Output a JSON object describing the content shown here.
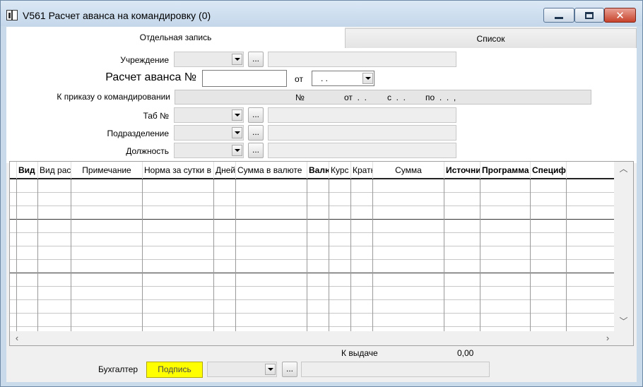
{
  "window": {
    "title": "V561 Расчет аванса на командировку (0)",
    "icon": "book-icon"
  },
  "tabs": [
    {
      "label": "Отдельная запись",
      "active": true
    },
    {
      "label": "Список",
      "active": false
    }
  ],
  "form": {
    "institution_label": "Учреждение",
    "advance_label": "Расчет аванса №",
    "advance_number": "",
    "from_label": "от",
    "date_value": ". .",
    "order_label": "К приказу о командировании",
    "order_parts": {
      "num": "№",
      "from": "от  .  .",
      "s": "с  .  .",
      "po": "по  .  .  ,"
    },
    "tab_label": "Таб №",
    "department_label": "Подразделение",
    "position_label": "Должность",
    "dots": "..."
  },
  "grid": {
    "columns": [
      {
        "label": "Вид",
        "bold": true
      },
      {
        "label": "Вид рас",
        "bold": false
      },
      {
        "label": "Примечание",
        "bold": false
      },
      {
        "label": "Норма за сутки в",
        "bold": false
      },
      {
        "label": "Дней",
        "bold": false
      },
      {
        "label": "Сумма в валюте",
        "bold": false
      },
      {
        "label": "Валю",
        "bold": true
      },
      {
        "label": "Курс",
        "bold": false
      },
      {
        "label": "Кратн",
        "bold": false
      },
      {
        "label": "Сумма",
        "bold": false
      },
      {
        "label": "Источни",
        "bold": true
      },
      {
        "label": "Программа",
        "bold": true
      },
      {
        "label": "Специф",
        "bold": true
      }
    ],
    "row_count": 11
  },
  "footer": {
    "payout_label": "К выдаче",
    "payout_value": "0,00",
    "accountant_label": "Бухгалтер",
    "sign_label": "Подпись"
  },
  "colors": {
    "sign_button": "#ffff00",
    "close_button": "#c7432c"
  }
}
